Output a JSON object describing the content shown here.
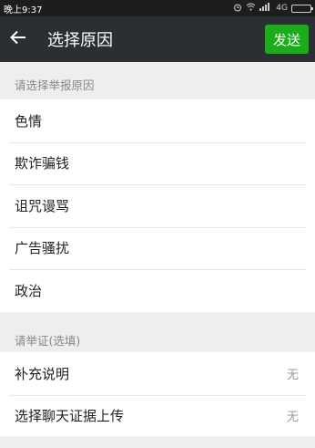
{
  "status_bar": {
    "time": "晚上9:37",
    "signal_text": "4G"
  },
  "header": {
    "title": "选择原因",
    "send_label": "发送"
  },
  "reason_section": {
    "header": "请选择举报原因",
    "items": [
      {
        "label": "色情"
      },
      {
        "label": "欺诈骗钱"
      },
      {
        "label": "诅咒谩骂"
      },
      {
        "label": "广告骚扰"
      },
      {
        "label": "政治"
      }
    ]
  },
  "evidence_section": {
    "header": "请举证(选填)",
    "items": [
      {
        "label": "补充说明",
        "value": "无"
      },
      {
        "label": "选择聊天证据上传",
        "value": "无"
      }
    ]
  },
  "colors": {
    "toolbar": "#2a2f32",
    "accent_green": "#1aad19",
    "background": "#eeeeee"
  }
}
